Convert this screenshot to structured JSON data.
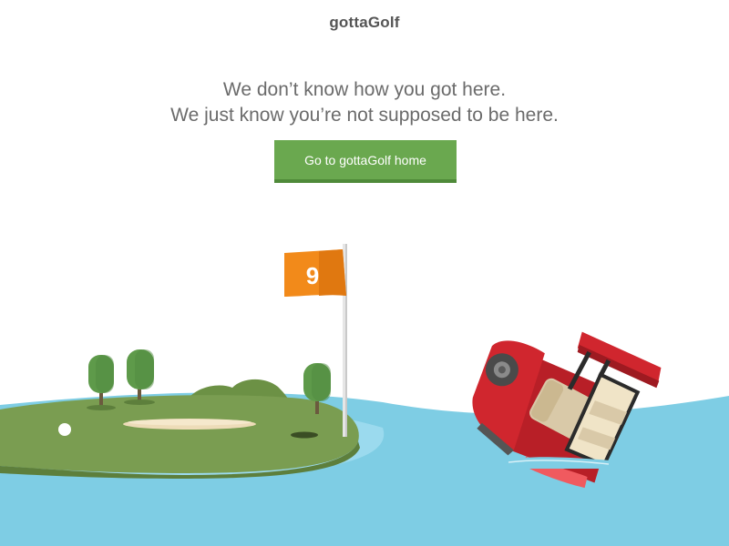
{
  "brand": {
    "name": "gottaGolf"
  },
  "message": {
    "line1": "We don’t know how you got here.",
    "line2": "We just know you’re not supposed to be here."
  },
  "cta": {
    "label": "Go to gottaGolf home"
  },
  "scene": {
    "flag_number": "9",
    "colors": {
      "water": "#7ecde4",
      "island": "#7a9d51",
      "tree": "#5e9a4a",
      "flag": "#f28a1a",
      "cart": "#d0262e",
      "button": "#6aa84f"
    },
    "icons": [
      "golf-flag-icon",
      "golf-ball-icon",
      "golf-cart-icon",
      "tree-icon",
      "sand-bunker-icon",
      "hole-icon"
    ]
  }
}
